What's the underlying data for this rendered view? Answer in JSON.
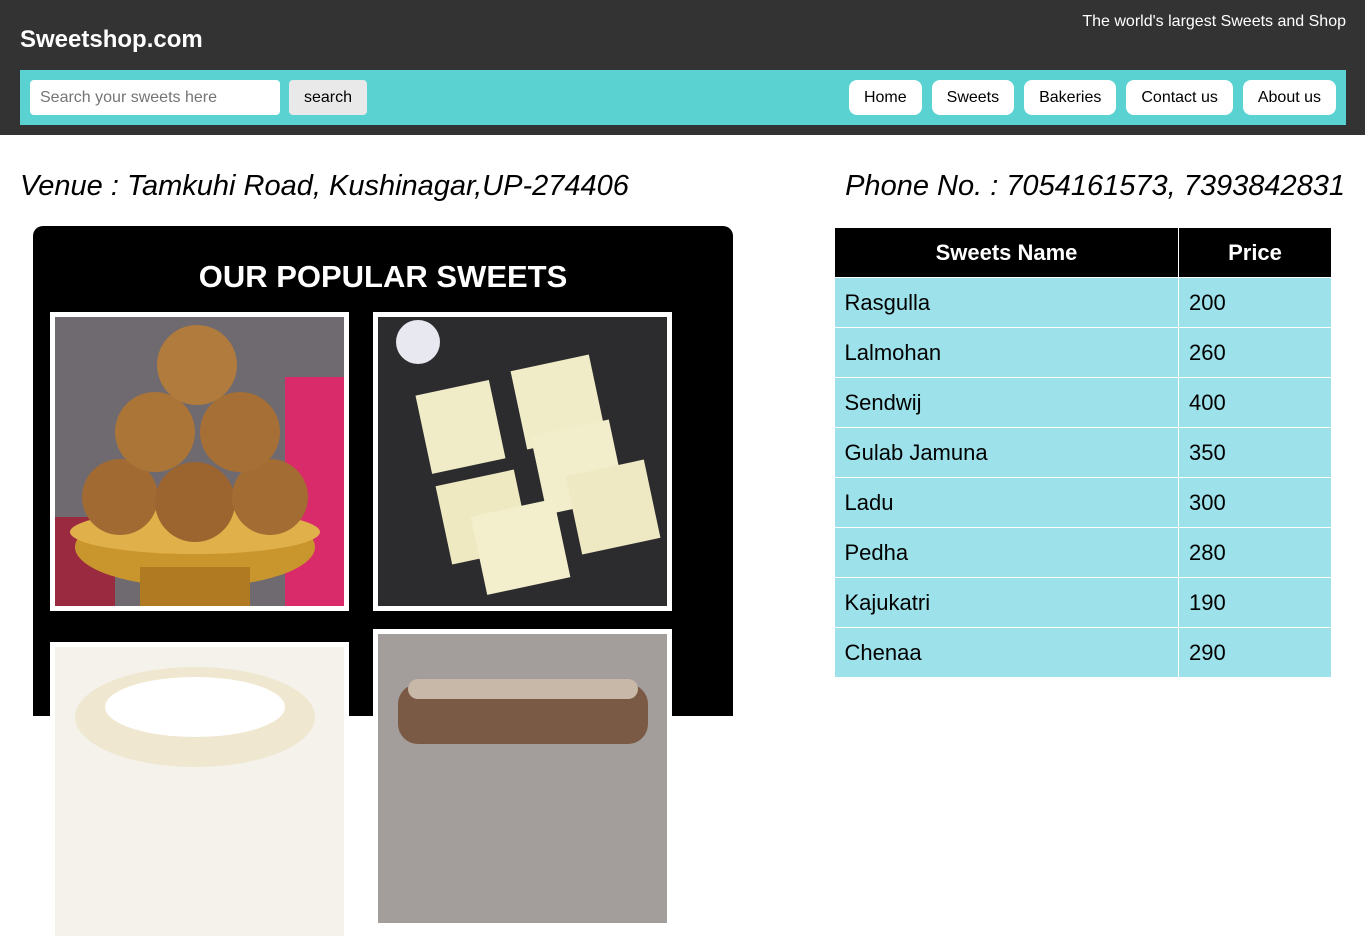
{
  "header": {
    "site_title": "Sweetshop.com",
    "tagline": "The world's largest Sweets and Shop"
  },
  "nav": {
    "search_placeholder": "Search your sweets here",
    "search_button": "search",
    "links": [
      "Home",
      "Sweets",
      "Bakeries",
      "Contact us",
      "About us"
    ]
  },
  "info": {
    "venue": "Venue : Tamkuhi Road, Kushinagar,UP-274406",
    "phone": "Phone No. : 7054161573, 7393842831"
  },
  "gallery": {
    "title": "OUR POPULAR SWEETS",
    "images": [
      "ladoo-photo",
      "barfi-photo",
      "rasmalai-photo",
      "kaju-roll-photo"
    ]
  },
  "price_table": {
    "headers": [
      "Sweets Name",
      "Price"
    ],
    "rows": [
      [
        "Rasgulla",
        "200"
      ],
      [
        "Lalmohan",
        "260"
      ],
      [
        "Sendwij",
        "400"
      ],
      [
        "Gulab Jamuna",
        "350"
      ],
      [
        "Ladu",
        "300"
      ],
      [
        "Pedha",
        "280"
      ],
      [
        "Kajukatri",
        "190"
      ],
      [
        "Chenaa",
        "290"
      ]
    ]
  },
  "colors": {
    "topbar": "#333333",
    "navbar": "#5bd2d2",
    "table_header": "#000000",
    "table_row": "#9de2ea"
  }
}
